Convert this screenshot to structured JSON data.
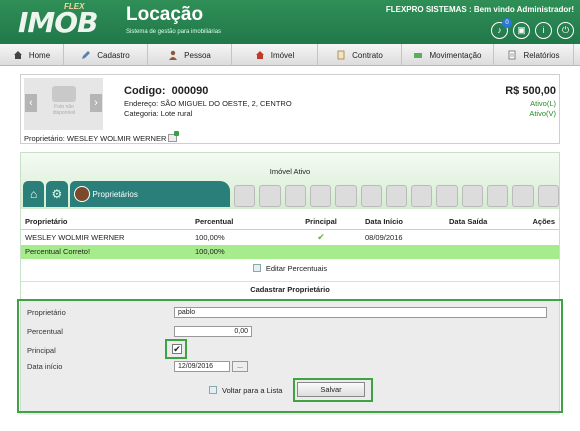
{
  "header": {
    "brand_small": "FLEX",
    "brand": "IMOB",
    "title": "Locação",
    "subtitle": "Sistema de gestão para imobiliárias",
    "welcome": "FLEXPRO SISTEMAS : Bem vindo Administrador!",
    "notifications_count": "0",
    "icons": [
      "bell-icon",
      "lock-icon",
      "info-icon",
      "power-icon"
    ]
  },
  "nav": {
    "items": [
      {
        "label": "Home",
        "icon": "home-icon"
      },
      {
        "label": "Cadastro",
        "icon": "pencil-icon"
      },
      {
        "label": "Pessoa",
        "icon": "person-icon"
      },
      {
        "label": "Imóvel",
        "icon": "house-icon"
      },
      {
        "label": "Contrato",
        "icon": "contract-icon"
      },
      {
        "label": "Movimentação",
        "icon": "money-icon"
      },
      {
        "label": "Relatórios",
        "icon": "report-icon"
      }
    ]
  },
  "property": {
    "no_photo": "Foto não disponível",
    "codigo_label": "Codigo:",
    "codigo": "000090",
    "endereco": "Endereço:  SÃO MIGUEL DO OESTE, 2, CENTRO",
    "categoria": "Categoria:  Lote rural",
    "price": "R$ 500,00",
    "ativo_l": "Ativo(L)",
    "ativo_v": "Ativo(V)",
    "proprietario": "Proprietário:  WESLEY WOLMIR WERNER"
  },
  "panel": {
    "status": "Imóvel Ativo",
    "active_tab": "Proprietários",
    "table": {
      "headers": [
        "Proprietário",
        "Percentual",
        "Principal",
        "Data Início",
        "Data Saída",
        "Ações"
      ],
      "rows": [
        {
          "proprietario": "WESLEY WOLMIR WERNER",
          "percentual": "100,00%",
          "principal": "✔",
          "data_inicio": "08/09/2016",
          "data_saida": "",
          "acoes": ""
        }
      ],
      "summary": {
        "label": "Percentual Correto!",
        "value": "100,00%"
      }
    },
    "edit_percentuais": "Editar Percentuais",
    "cadastrar_title": "Cadastrar Proprietário"
  },
  "form": {
    "proprietario_label": "Proprietário",
    "proprietario_value": "pablo",
    "percentual_label": "Percentual",
    "percentual_value": "0,00",
    "principal_label": "Principal",
    "principal_checked": true,
    "data_inicio_label": "Data início",
    "data_inicio_value": "12/09/2016",
    "date_picker": "...",
    "voltar_label": "Voltar para a Lista",
    "salvar_label": "Salvar"
  },
  "colors": {
    "header_green": "#21784a",
    "tab_teal": "#2a7f7a",
    "success_row": "#a6ec8c",
    "highlight": "#3fa243"
  }
}
